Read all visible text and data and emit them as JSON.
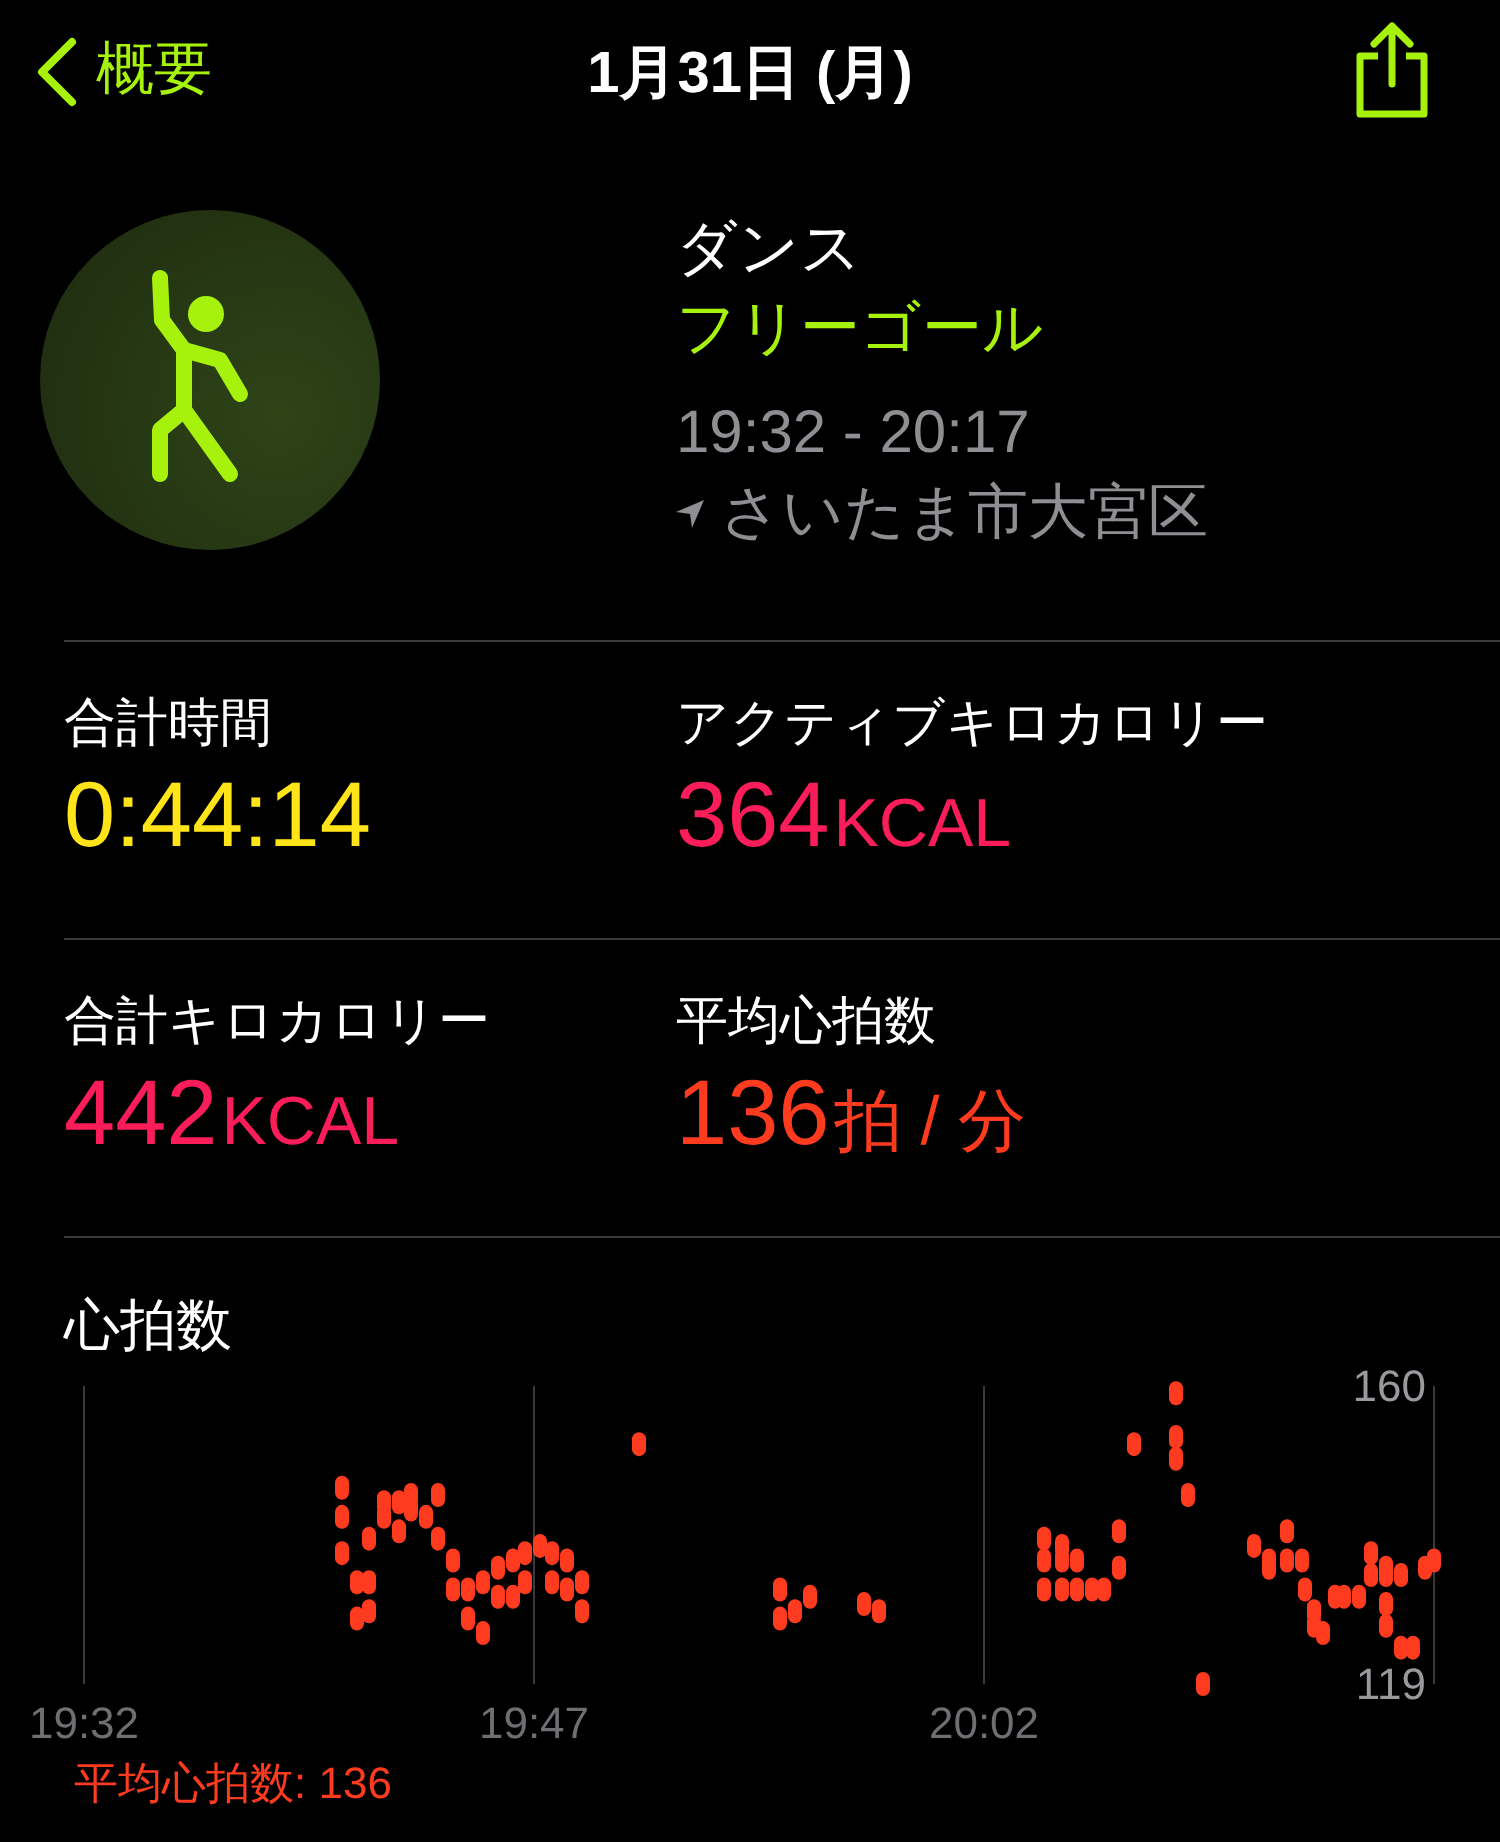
{
  "nav": {
    "back_label": "概要",
    "title": "1月31日 (月)"
  },
  "workout": {
    "name": "ダンス",
    "goal": "フリーゴール",
    "time_range": "19:32 - 20:17",
    "location": "さいたま市大宮区"
  },
  "stats": [
    {
      "label": "合計時間",
      "value": "0:44:14",
      "color": "#ffe419"
    },
    {
      "label": "アクティブキロカロリー",
      "value": "364",
      "unit": "KCAL",
      "color": "#fa1d5a"
    },
    {
      "label": "合計キロカロリー",
      "value": "442",
      "unit": "KCAL",
      "color": "#fa1d5a"
    },
    {
      "label": "平均心拍数",
      "value": "136",
      "unit": "拍 / 分",
      "color": "#ff3b1f"
    }
  ],
  "heart_rate": {
    "title": "心拍数",
    "average": "平均心拍数: 136",
    "chart_data": {
      "type": "scatter",
      "xlim": [
        1172,
        1217
      ],
      "ylim": [
        119,
        160
      ],
      "xticks": [
        {
          "value": 1172,
          "label": "19:32"
        },
        {
          "value": 1187,
          "label": "19:47"
        },
        {
          "value": 1202,
          "label": "20:02"
        }
      ],
      "yticks": [
        119,
        160
      ],
      "x": [
        1180.6,
        1180.6,
        1180.6,
        1181.1,
        1181.1,
        1181.5,
        1181.5,
        1181.5,
        1182,
        1182,
        1182.5,
        1182.5,
        1182.9,
        1182.9,
        1183.4,
        1183.8,
        1183.8,
        1184.3,
        1184.3,
        1184.8,
        1184.8,
        1185.3,
        1185.3,
        1185.8,
        1185.8,
        1186.3,
        1186.3,
        1186.7,
        1186.7,
        1187.2,
        1187.6,
        1187.6,
        1188.1,
        1188.1,
        1188.6,
        1188.6,
        1190.5,
        1195.2,
        1195.2,
        1195.7,
        1196.2,
        1198,
        1198.5,
        1204,
        1204,
        1204,
        1204.6,
        1204.6,
        1204.6,
        1205.1,
        1205.1,
        1205.6,
        1206,
        1206.5,
        1206.5,
        1207,
        1208.4,
        1208.4,
        1208.4,
        1208.8,
        1209.3,
        1211,
        1211.5,
        1211.5,
        1212.1,
        1212.1,
        1212.6,
        1212.7,
        1213,
        1213,
        1213.3,
        1213.7,
        1214,
        1214.5,
        1214.9,
        1214.9,
        1215.4,
        1215.4,
        1215.4,
        1215.4,
        1215.9,
        1215.9,
        1216.3,
        1216.7,
        1217
      ],
      "series": [
        {
          "color": "#ff3b1f",
          "values": [
            146,
            142,
            137,
            133,
            128,
            139,
            133,
            129,
            144,
            142,
            144,
            140,
            145,
            143,
            142,
            145,
            139,
            136,
            132,
            132,
            128,
            133,
            126,
            135,
            131,
            136,
            131,
            137,
            133,
            138,
            137,
            133,
            136,
            132,
            133,
            129,
            152,
            132,
            128,
            129,
            131,
            130,
            129,
            139,
            136,
            132,
            138,
            136,
            132,
            136,
            132,
            132,
            132,
            140,
            135,
            152,
            159,
            153,
            150,
            145,
            119,
            138,
            136,
            135,
            140,
            136,
            136,
            132,
            129,
            127,
            126,
            131,
            131,
            131,
            134,
            137,
            135,
            134,
            130,
            127,
            124,
            134,
            124,
            135,
            136
          ]
        }
      ]
    }
  }
}
